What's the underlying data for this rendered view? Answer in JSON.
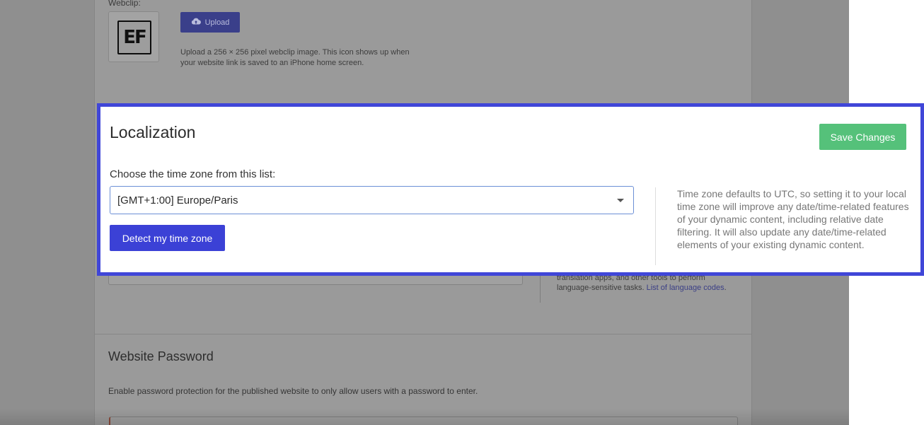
{
  "background": {
    "webclip_label": "Webclip:",
    "webclip_logo_text": "EF",
    "upload_label": "Upload",
    "webclip_help": "Upload a 256 × 256 pixel webclip image. This icon shows up when your website link is saved to an iPhone home screen.",
    "language_help": "translation apps, and other tools to perform language-sensitive tasks.",
    "language_link": "List of language codes",
    "password_section_title": "Website Password",
    "password_help": "Enable password protection for the published website to only allow users with a password to enter."
  },
  "localization": {
    "title": "Localization",
    "save_label": "Save Changes",
    "timezone_label": "Choose the time zone from this list:",
    "timezone_value": "[GMT+1:00] Europe/Paris",
    "detect_label": "Detect my time zone",
    "timezone_help": "Time zone defaults to UTC, so setting it to your local time zone will improve any date/time-related features of your dynamic content, including relative date filtering. It will also update any date/time-related elements of your existing dynamic content."
  },
  "colors": {
    "highlight_border": "#4046d8",
    "save_button": "#55c17a",
    "detect_button": "#3b41d6",
    "overlay": "#8f8f8f"
  },
  "icons": {
    "upload": "cloud-upload-icon",
    "select_caret": "caret-down-icon"
  }
}
